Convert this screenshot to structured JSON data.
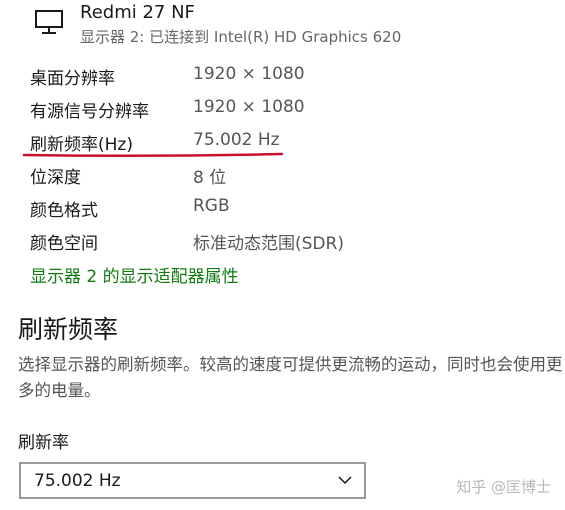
{
  "display": {
    "name": "Redmi 27 NF",
    "subtitle": "显示器 2: 已连接到 Intel(R) HD Graphics 620",
    "icon": "monitor-icon"
  },
  "properties": [
    {
      "label": "桌面分辨率",
      "value": "1920 × 1080"
    },
    {
      "label": "有源信号分辨率",
      "value": "1920 × 1080"
    },
    {
      "label": "刷新频率(Hz)",
      "value": "75.002 Hz"
    },
    {
      "label": "位深度",
      "value": "8 位"
    },
    {
      "label": "颜色格式",
      "value": "RGB"
    },
    {
      "label": "颜色空间",
      "value": "标准动态范围(SDR)"
    }
  ],
  "adapter_link": "显示器 2 的显示适配器属性",
  "refresh_section": {
    "title": "刷新频率",
    "description": "选择显示器的刷新频率。较高的速度可提供更流畅的运动，同时也会使用更多的电量。",
    "rate_label": "刷新率",
    "selected_rate": "75.002 Hz"
  },
  "watermark": "知乎 @匡博士",
  "colors": {
    "link": "#107c10",
    "annotation": "#c8102e",
    "secondary_text": "#555555"
  }
}
